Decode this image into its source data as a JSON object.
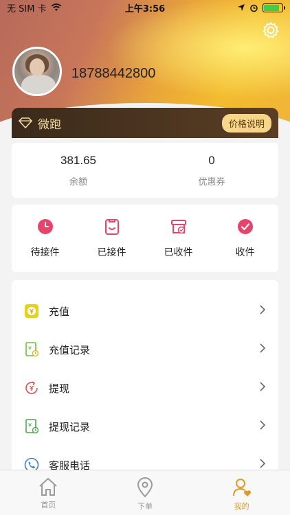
{
  "status_bar": {
    "carrier": "无 SIM 卡",
    "time": "上午3:56"
  },
  "profile": {
    "phone": "18788442800"
  },
  "member": {
    "label": "微跑",
    "price_button": "价格说明"
  },
  "balance": {
    "items": [
      {
        "value": "381.65",
        "caption": "余额"
      },
      {
        "value": "0",
        "caption": "优惠券"
      }
    ]
  },
  "orders": {
    "items": [
      {
        "label": "待接件",
        "icon": "clock-icon"
      },
      {
        "label": "已接件",
        "icon": "clipboard-icon"
      },
      {
        "label": "已收件",
        "icon": "box-check-icon"
      },
      {
        "label": "收件",
        "icon": "check-circle-icon"
      }
    ]
  },
  "menu": {
    "items": [
      {
        "label": "充值",
        "icon": "yen-wallet-icon"
      },
      {
        "label": "充值记录",
        "icon": "recharge-record-icon"
      },
      {
        "label": "提现",
        "icon": "withdraw-icon"
      },
      {
        "label": "提现记录",
        "icon": "withdraw-record-icon"
      },
      {
        "label": "客服电话",
        "icon": "phone-icon"
      }
    ]
  },
  "tabs": {
    "items": [
      {
        "label": "首页",
        "icon": "home-icon"
      },
      {
        "label": "下单",
        "icon": "location-pin-icon"
      },
      {
        "label": "我的",
        "icon": "user-heart-icon"
      }
    ],
    "active": "我的"
  },
  "colors": {
    "accent": "#e09a22",
    "pink": "#e8436b",
    "member_bar": "#3b2a1b"
  }
}
